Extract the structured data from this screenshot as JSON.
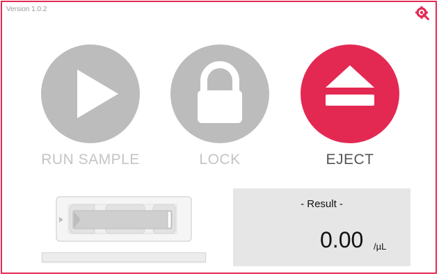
{
  "app": {
    "version": "Version 1.0.2"
  },
  "colors": {
    "accent": "#e32952",
    "disabled": "#bcbcbc",
    "panel": "#e6e6e6"
  },
  "header": {
    "settings_icon": "settings-gear-magnifier-icon"
  },
  "actions": {
    "run": {
      "label": "RUN SAMPLE",
      "icon": "play-icon",
      "state": "disabled"
    },
    "lock": {
      "label": "LOCK",
      "icon": "lock-icon",
      "state": "disabled"
    },
    "eject": {
      "label": "EJECT",
      "icon": "eject-icon",
      "state": "active"
    }
  },
  "cartridge": {
    "icon": "cartridge-icon"
  },
  "progress": {
    "value": 0
  },
  "result": {
    "title": "- Result -",
    "value": "0.00",
    "unit": "/µL"
  }
}
